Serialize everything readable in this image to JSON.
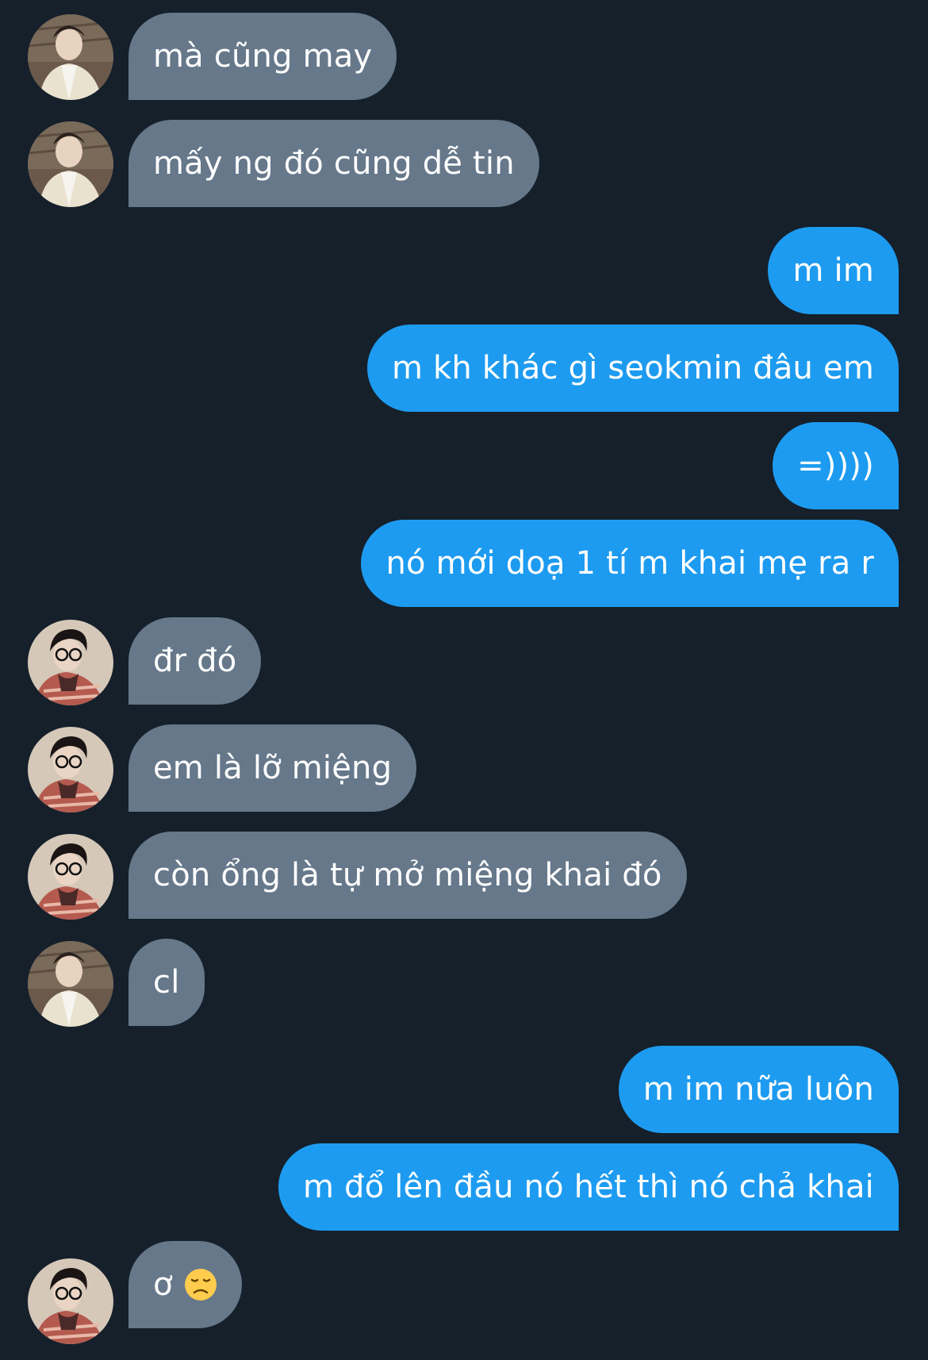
{
  "conversation": {
    "messages": [
      {
        "sender": "other",
        "avatar": "avatar-a",
        "text": "mà cũng may"
      },
      {
        "sender": "other",
        "avatar": "avatar-a",
        "text": "mấy ng đó cũng dễ tin"
      },
      {
        "sender": "me",
        "text": "m im"
      },
      {
        "sender": "me",
        "text": "m kh khác gì seokmin đâu em"
      },
      {
        "sender": "me",
        "text": "=))))"
      },
      {
        "sender": "me",
        "text": "nó mới doạ 1 tí m khai mẹ ra r"
      },
      {
        "sender": "other",
        "avatar": "avatar-b",
        "text": "đr đó"
      },
      {
        "sender": "other",
        "avatar": "avatar-b",
        "text": "em là lỡ miệng"
      },
      {
        "sender": "other",
        "avatar": "avatar-b",
        "text": "còn ổng là tự mở miệng khai đó"
      },
      {
        "sender": "other",
        "avatar": "avatar-a",
        "text": "cl"
      },
      {
        "sender": "me",
        "text": "m im nữa luôn"
      },
      {
        "sender": "me",
        "text": "m đổ lên đầu nó hết thì nó chả khai"
      },
      {
        "sender": "other",
        "avatar": "avatar-b",
        "text": "ơ",
        "emoji": "disappointed-face-emoji"
      }
    ]
  },
  "colors": {
    "background": "#15202b",
    "received_bubble": "#66788a",
    "sent_bubble": "#1d9bf0",
    "text": "#ffffff"
  }
}
